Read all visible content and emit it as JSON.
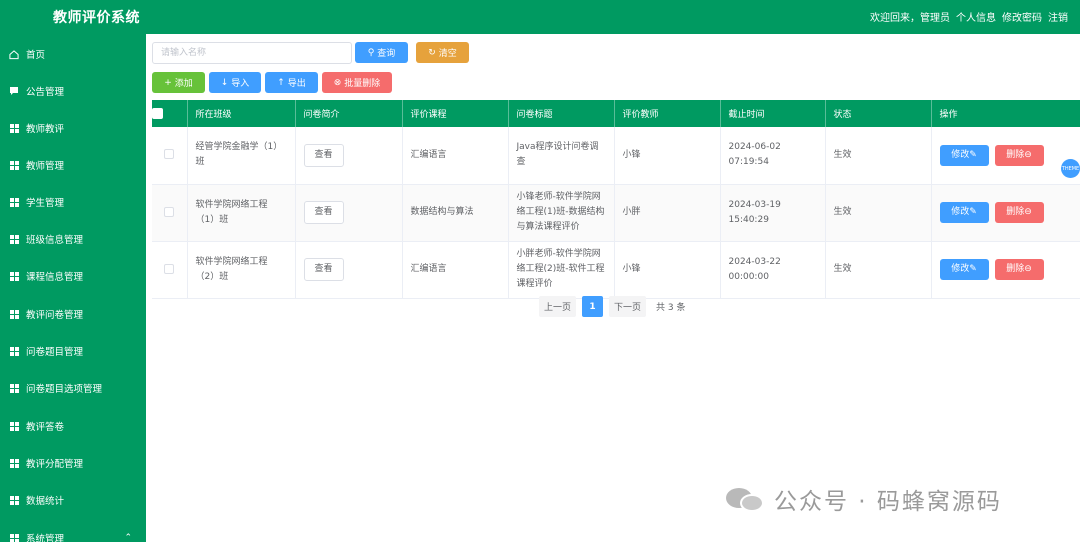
{
  "header": {
    "title": "教师评价系统",
    "welcome": "欢迎回来，管理员",
    "profile": "个人信息",
    "change_password": "修改密码",
    "logout": "注销"
  },
  "sidebar": {
    "items": [
      {
        "label": "首页",
        "icon": "home-icon"
      },
      {
        "label": "公告管理",
        "icon": "chat-icon"
      },
      {
        "label": "教师教评",
        "icon": "grid-icon"
      },
      {
        "label": "教师管理",
        "icon": "grid-icon"
      },
      {
        "label": "学生管理",
        "icon": "grid-icon"
      },
      {
        "label": "班级信息管理",
        "icon": "grid-icon"
      },
      {
        "label": "课程信息管理",
        "icon": "grid-icon"
      },
      {
        "label": "教评问卷管理",
        "icon": "grid-icon"
      },
      {
        "label": "问卷题目管理",
        "icon": "grid-icon"
      },
      {
        "label": "问卷题目选项管理",
        "icon": "grid-icon"
      },
      {
        "label": "教评答卷",
        "icon": "grid-icon"
      },
      {
        "label": "教评分配管理",
        "icon": "grid-icon"
      },
      {
        "label": "数据统计",
        "icon": "grid-icon"
      },
      {
        "label": "系统管理",
        "icon": "grid-icon"
      }
    ]
  },
  "toolbar": {
    "search_placeholder": "请输入名称",
    "query_label": "查询",
    "clear_label": "清空",
    "add_label": "添加",
    "import_label": "导入",
    "export_label": "导出",
    "batch_delete_label": "批量删除"
  },
  "table": {
    "headers": [
      "所在班级",
      "问卷简介",
      "评价课程",
      "问卷标题",
      "评价教师",
      "截止时间",
      "状态",
      "操作"
    ],
    "view_label": "查看",
    "edit_label": "修改",
    "delete_label": "删除",
    "rows": [
      {
        "class_name": "经管学院金融学（1）班",
        "course": "汇编语言",
        "title": "Java程序设计问卷调查",
        "teacher": "小锋",
        "deadline": "2024-06-02 07:19:54",
        "status": "生效"
      },
      {
        "class_name": "软件学院网络工程（1）班",
        "course": "数据结构与算法",
        "title": "小锋老师-软件学院网络工程(1)班-数据结构与算法课程评价",
        "teacher": "小胖",
        "deadline": "2024-03-19 15:40:29",
        "status": "生效"
      },
      {
        "class_name": "软件学院网络工程（2）班",
        "course": "汇编语言",
        "title": "小胖老师-软件学院网络工程(2)班-软件工程课程评价",
        "teacher": "小锋",
        "deadline": "2024-03-22 00:00:00",
        "status": "生效"
      }
    ]
  },
  "pagination": {
    "prev": "上一页",
    "current": "1",
    "next": "下一页",
    "total": "共 3 条"
  },
  "theme_button": "THEME",
  "watermark": "公众号 · 码蜂窝源码",
  "colors": {
    "primary_green": "#009a61",
    "blue": "#409eff",
    "orange": "#e6a23c",
    "green_btn": "#67c23a",
    "red": "#f56c6c"
  }
}
